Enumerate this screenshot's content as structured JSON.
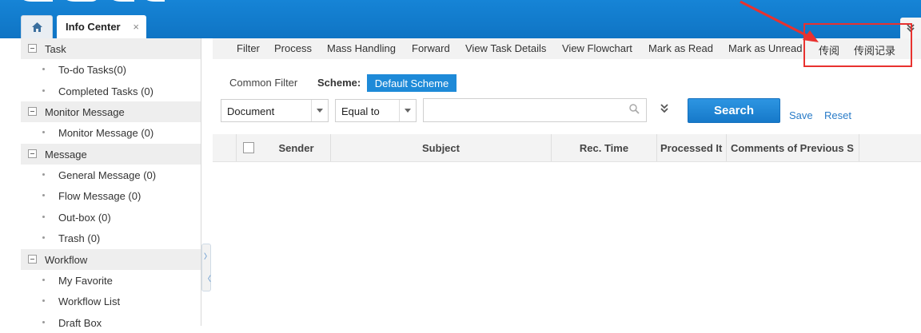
{
  "tabs": {
    "home_icon": "home-icon",
    "info_center": "Info Center",
    "close_glyph": "×"
  },
  "sidebar": {
    "groups": [
      {
        "label": "Task",
        "items": [
          "To-do Tasks(0)",
          "Completed Tasks (0)"
        ]
      },
      {
        "label": "Monitor Message",
        "items": [
          "Monitor Message (0)"
        ]
      },
      {
        "label": "Message",
        "items": [
          "General Message (0)",
          "Flow Message (0)",
          "Out-box (0)",
          "Trash (0)"
        ]
      },
      {
        "label": "Workflow",
        "items": [
          "My Favorite",
          "Workflow List",
          "Draft Box"
        ]
      }
    ]
  },
  "toolbar": {
    "filter": "Filter",
    "process": "Process",
    "mass_handling": "Mass Handling",
    "forward": "Forward",
    "view_task_details": "View Task Details",
    "view_flowchart": "View Flowchart",
    "mark_as_read": "Mark as Read",
    "mark_as_unread": "Mark as Unread",
    "circulate": "传阅",
    "circulate_record": "传阅记录"
  },
  "filter": {
    "common_filter": "Common Filter",
    "scheme_label": "Scheme:",
    "scheme_value": "Default Scheme",
    "field_select": "Document",
    "operator_select": "Equal to",
    "search_value": "",
    "search_button": "Search",
    "save_link": "Save",
    "reset_link": "Reset"
  },
  "table": {
    "columns": [
      "Sender",
      "Subject",
      "Rec. Time",
      "Processed It",
      "Comments of Previous S"
    ],
    "rows": []
  },
  "colors": {
    "brand_blue": "#1684d6",
    "accent_blue": "#1e8ad8",
    "annotation_red": "#e8322f"
  }
}
